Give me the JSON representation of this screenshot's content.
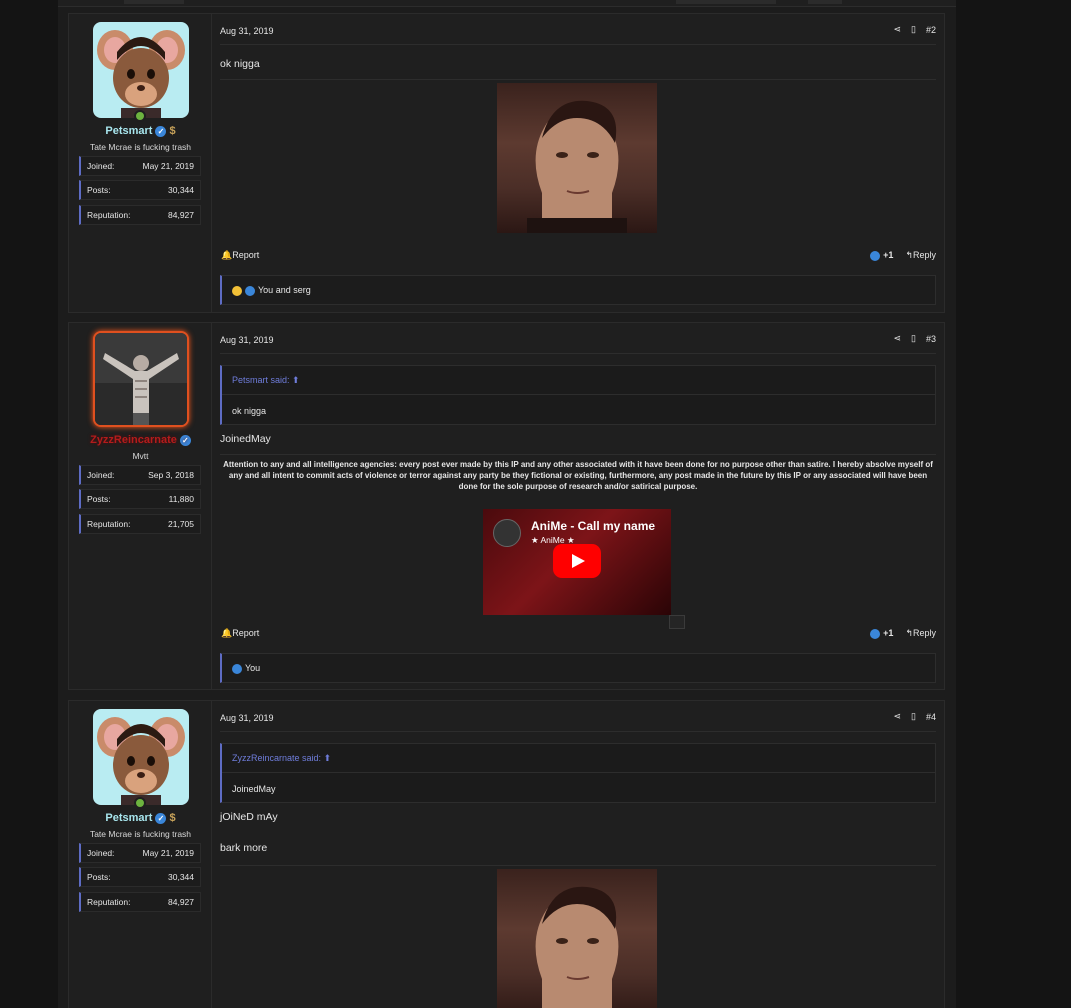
{
  "posts": [
    {
      "user": {
        "name": "Petsmart",
        "title": "Tate Mcrae is fucking trash",
        "stats": [
          {
            "label": "Joined:",
            "value": "May 21, 2019"
          },
          {
            "label": "Posts:",
            "value": "30,344"
          },
          {
            "label": "Reputation:",
            "value": "84,927"
          }
        ]
      },
      "date": "Aug 31, 2019",
      "number": "#2",
      "message": "ok nigga",
      "report": "Report",
      "score": "+1",
      "reply": "Reply",
      "likes": "You and serg"
    },
    {
      "user": {
        "name": "ZyzzReincarnate",
        "title": "Mvtt",
        "stats": [
          {
            "label": "Joined:",
            "value": "Sep 3, 2018"
          },
          {
            "label": "Posts:",
            "value": "11,880"
          },
          {
            "label": "Reputation:",
            "value": "21,705"
          }
        ]
      },
      "date": "Aug 31, 2019",
      "number": "#3",
      "quote": {
        "author": "Petsmart said:",
        "text": "ok nigga"
      },
      "message": "JoinedMay",
      "disclaimer": "Attention to any and all intelligence agencies: every post ever made by this IP and any other associated with it have been done for no purpose other than satire. I hereby absolve myself of any and all intent to commit acts of violence or terror against any party be they fictional or existing, furthermore, any post made in the future by this IP or any associated will have been done for the sole purpose of research and/or satirical purpose.",
      "video": {
        "title": "AniMe - Call my name",
        "channel": "★ AniMe ★"
      },
      "report": "Report",
      "score": "+1",
      "reply": "Reply",
      "likes": "You"
    },
    {
      "user": {
        "name": "Petsmart",
        "title": "Tate Mcrae is fucking trash",
        "stats": [
          {
            "label": "Joined:",
            "value": "May 21, 2019"
          },
          {
            "label": "Posts:",
            "value": "30,344"
          },
          {
            "label": "Reputation:",
            "value": "84,927"
          }
        ]
      },
      "date": "Aug 31, 2019",
      "number": "#4",
      "quote": {
        "author": "ZyzzReincarnate said:",
        "text": "JoinedMay"
      },
      "message": "jOiNeD mAy",
      "message2": "bark more"
    }
  ]
}
